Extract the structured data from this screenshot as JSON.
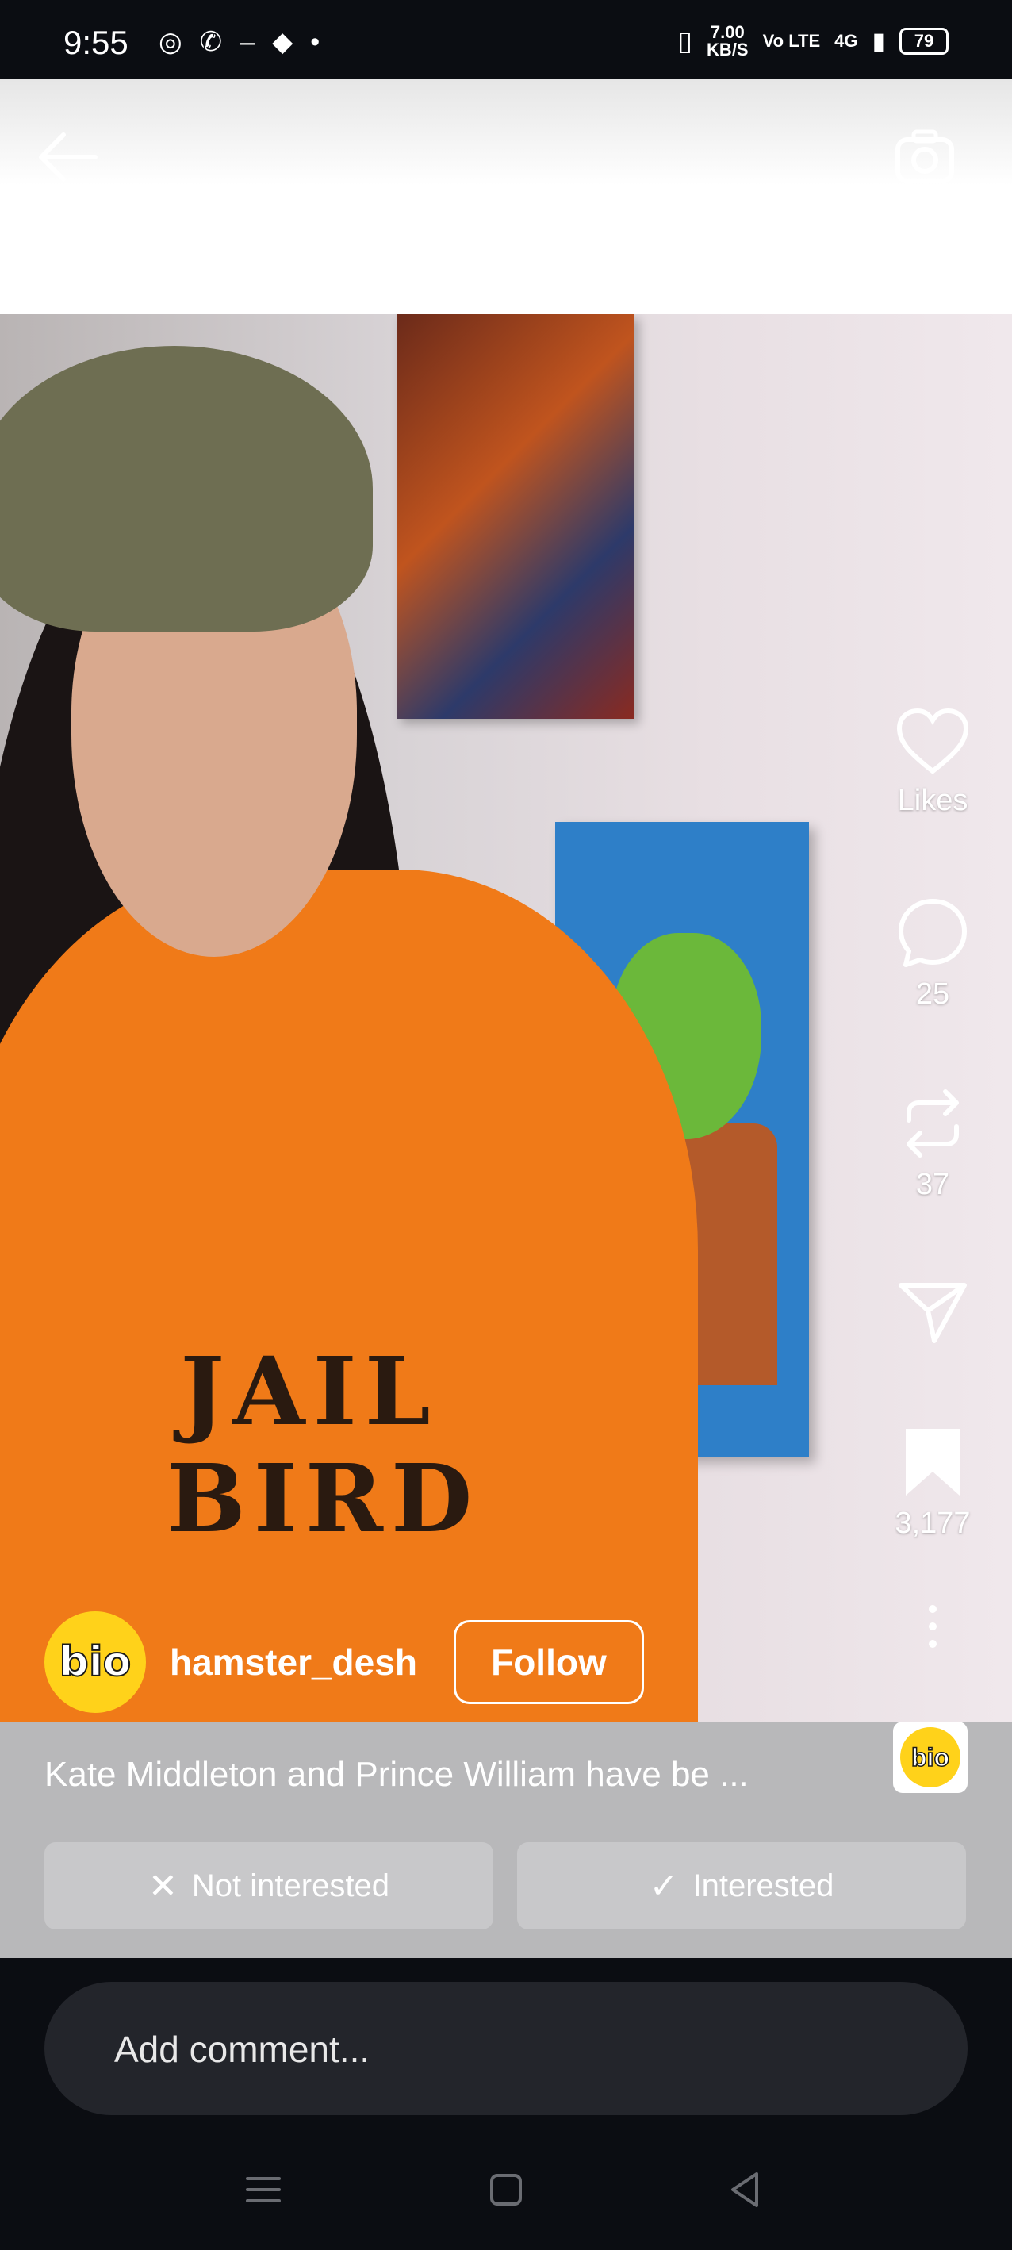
{
  "status_bar": {
    "time": "9:55",
    "speed_value": "7.00",
    "speed_unit": "KB/S",
    "volte": "Vo LTE",
    "network": "4G",
    "battery": "79"
  },
  "post": {
    "author": {
      "username": "hamster_desh",
      "avatar_text": "bio"
    },
    "follow_label": "Follow",
    "printed_shirt_text": [
      "JAIL",
      "BIRD"
    ],
    "caption": "Kate Middleton and Prince William have be ...",
    "badge_text": "bio"
  },
  "actions": {
    "likes_label": "Likes",
    "comments_count": "25",
    "reposts_count": "37",
    "saves_count": "3,177"
  },
  "interest": {
    "not_interested_label": "Not interested",
    "interested_label": "Interested"
  },
  "comment": {
    "placeholder": "Add comment..."
  },
  "colors": {
    "avatar_yellow": "#ffd21a",
    "hoodie_orange": "#f07a18",
    "background_dark": "#0b0d12"
  }
}
